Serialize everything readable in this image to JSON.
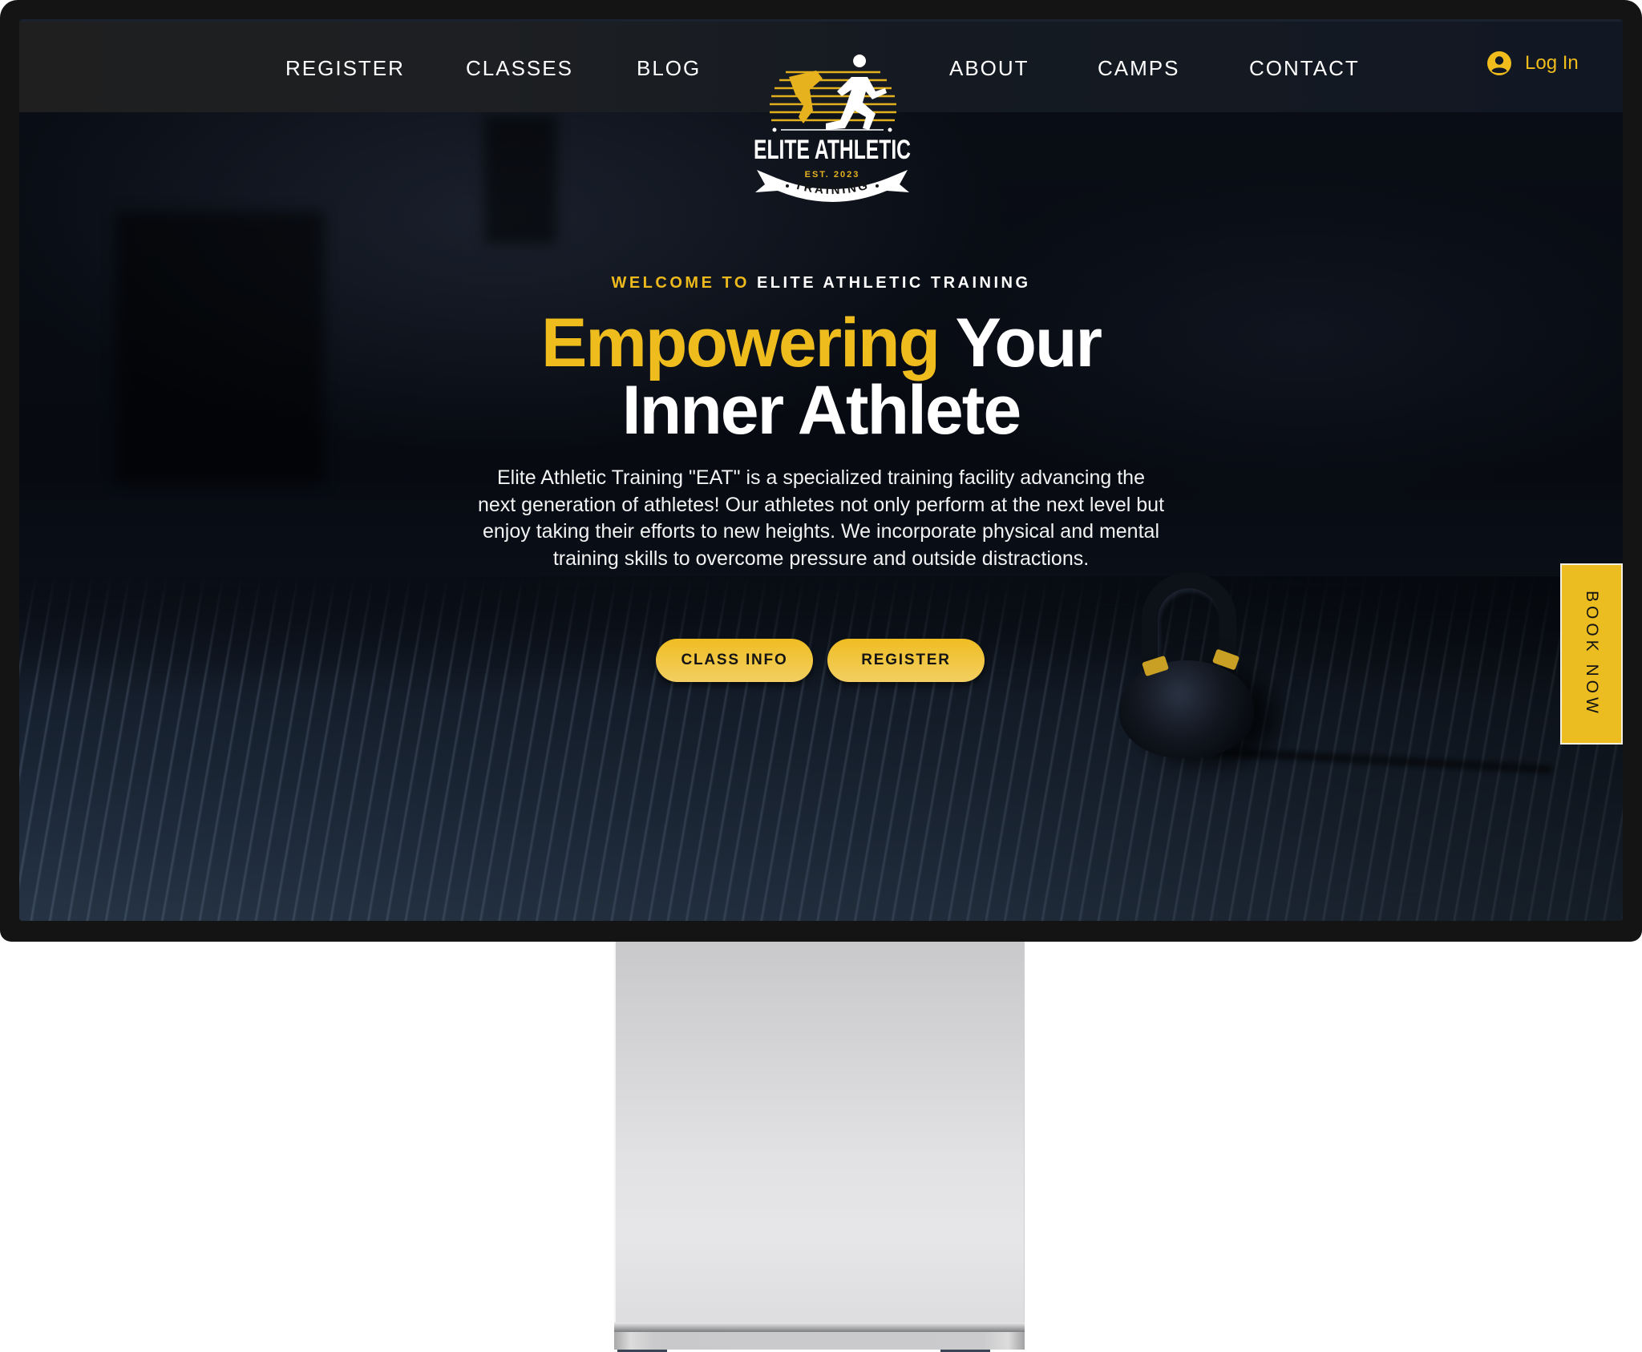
{
  "site": {
    "brand": {
      "name_line1": "ELITE ATHLETIC",
      "established": "EST. 2023",
      "name_line2": "TRAINING"
    },
    "nav": {
      "left_items": [
        {
          "label": "REGISTER"
        },
        {
          "label": "CLASSES"
        },
        {
          "label": "BLOG"
        }
      ],
      "right_items": [
        {
          "label": "ABOUT"
        },
        {
          "label": "CAMPS"
        },
        {
          "label": "CONTACT"
        }
      ],
      "login": {
        "label": "Log In",
        "icon": "user-circle-icon"
      }
    },
    "hero": {
      "eyebrow_accent": "WELCOME TO",
      "eyebrow_rest": "ELITE ATHLETIC TRAINING",
      "headline_accent": "Empowering",
      "headline_rest_line1": "Your",
      "headline_line2": "Inner Athlete",
      "description": "Elite Athletic Training \"EAT\" is a specialized training facility advancing the next generation of athletes! Our athletes not only perform at the next level but enjoy taking their efforts to new heights. We incorporate physical and mental training skills to overcome pressure and outside distractions.",
      "buttons": [
        {
          "label": "CLASS INFO"
        },
        {
          "label": "REGISTER"
        }
      ]
    },
    "book_now": {
      "label": "BOOK NOW"
    }
  },
  "colors": {
    "accent": "#EFBC1E",
    "nav_bg": "#121823",
    "bezel": "#141414",
    "text_light": "#FFFFFF",
    "button_text": "#141414"
  }
}
